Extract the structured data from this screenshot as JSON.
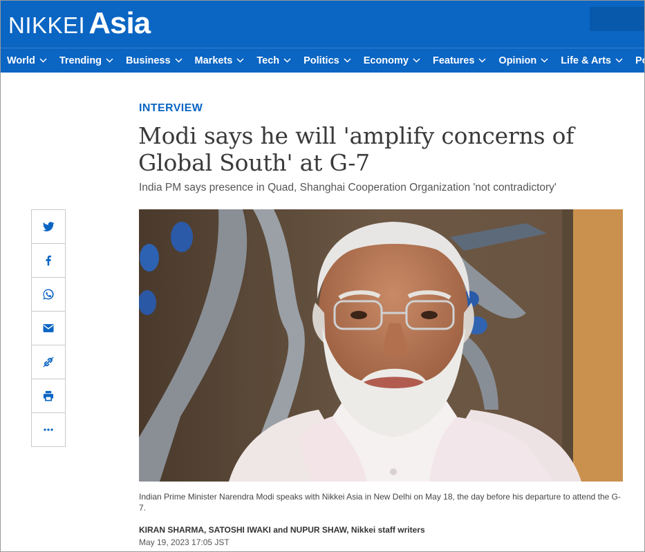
{
  "brand": {
    "name_part1": "NIKKEI",
    "name_part2": "Asia"
  },
  "nav": {
    "items": [
      {
        "label": "World",
        "dropdown": true
      },
      {
        "label": "Trending",
        "dropdown": true
      },
      {
        "label": "Business",
        "dropdown": true
      },
      {
        "label": "Markets",
        "dropdown": true
      },
      {
        "label": "Tech",
        "dropdown": true
      },
      {
        "label": "Politics",
        "dropdown": true
      },
      {
        "label": "Economy",
        "dropdown": true
      },
      {
        "label": "Features",
        "dropdown": true
      },
      {
        "label": "Opinion",
        "dropdown": true
      },
      {
        "label": "Life & Arts",
        "dropdown": true
      },
      {
        "label": "Podcast",
        "dropdown": false
      }
    ]
  },
  "article": {
    "kicker": "INTERVIEW",
    "title": "Modi says he will 'amplify concerns of Global South' at G-7",
    "subtitle": "India PM says presence in Quad, Shanghai Cooperation Organization 'not contradictory'",
    "caption": "Indian Prime Minister Narendra Modi speaks with Nikkei Asia in New Delhi on May 18, the day before his departure to attend the G-7.",
    "byline": "KIRAN SHARMA, SATOSHI IWAKI and NUPUR SHAW, Nikkei staff writers",
    "date": "May 19, 2023 17:05 JST"
  },
  "share": {
    "buttons": [
      "twitter-icon",
      "facebook-icon",
      "whatsapp-icon",
      "email-icon",
      "link-icon",
      "print-icon",
      "more-icon"
    ]
  },
  "colors": {
    "brand_blue": "#0a65c3",
    "kicker_blue": "#0a65c3",
    "icon_blue": "#0a65c3"
  }
}
